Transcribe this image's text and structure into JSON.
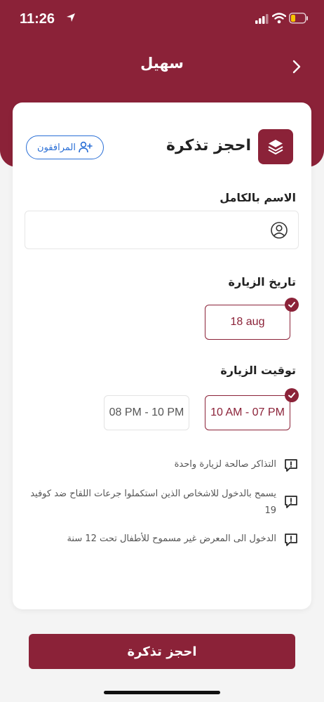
{
  "status": {
    "time": "11:26"
  },
  "header": {
    "title": "سهيل"
  },
  "card": {
    "title": "احجز تذكرة",
    "companions_label": "المرافقون"
  },
  "form": {
    "name_label": "الاسم بالكامل",
    "name_value": "",
    "name_placeholder": "",
    "date_label": "تاريخ الزيارة",
    "dates": [
      {
        "label": "18 aug",
        "selected": true
      }
    ],
    "time_label": "توقيت الزيارة",
    "times": [
      {
        "label": "10 AM - 07 PM",
        "selected": true
      },
      {
        "label": "08 PM - 10 PM",
        "selected": false
      }
    ]
  },
  "notes": [
    "التذاكر صالحة لزيارة واحدة",
    "يسمح بالدخول للاشخاص الذين استكملوا جرعات اللقاح ضد كوفيد 19",
    "الدخول الى المعرض غير مسموح للأطفال تحت 12 سنة"
  ],
  "footer": {
    "book_label": "احجز تذكرة"
  },
  "colors": {
    "brand": "#8b2238",
    "link": "#2a6fd6",
    "background": "#f4f4f4"
  },
  "icons": {
    "back": "chevron-right-icon",
    "card": "layers-icon",
    "companions": "add-user-icon",
    "name": "user-icon",
    "check": "check-icon",
    "info": "alert-message-icon"
  }
}
